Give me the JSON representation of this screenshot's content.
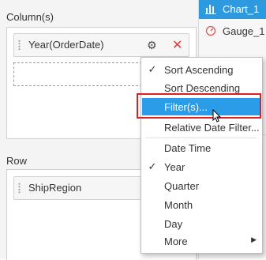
{
  "columns": {
    "title": "Column(s)",
    "chip_label": "Year(OrderDate)"
  },
  "row": {
    "title": "Row",
    "chip_label": "ShipRegion"
  },
  "widgets": [
    {
      "label": "Chart_1",
      "icon": "bar-chart-icon",
      "active": true
    },
    {
      "label": "Gauge_1",
      "icon": "gauge-icon",
      "active": false
    }
  ],
  "context_menu": {
    "items": [
      {
        "label": "Sort Ascending",
        "checked": true
      },
      {
        "label": "Sort Descending",
        "checked": false
      },
      {
        "label": "Filter(s)...",
        "checked": false,
        "highlighted": true
      },
      {
        "label": "Relative Date Filter...",
        "checked": false
      },
      {
        "label": "Date Time",
        "checked": false
      },
      {
        "label": "Year",
        "checked": true
      },
      {
        "label": "Quarter",
        "checked": false
      },
      {
        "label": "Month",
        "checked": false
      },
      {
        "label": "Day",
        "checked": false
      },
      {
        "label": "More",
        "checked": false,
        "submenu": true
      }
    ],
    "check_mark": "✓"
  },
  "colors": {
    "highlight": "#2a9ce8",
    "annotation": "#e02020",
    "active_widget": "#2d9ae0"
  }
}
